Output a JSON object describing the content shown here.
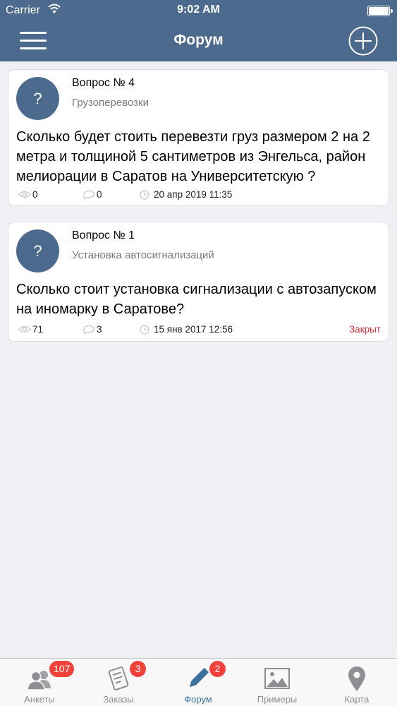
{
  "status_bar": {
    "carrier": "Carrier",
    "time": "9:02 AM"
  },
  "nav": {
    "title": "Форум"
  },
  "questions": [
    {
      "number": "Вопрос № 4",
      "category": "Грузоперевозки",
      "avatar": "?",
      "text": "Сколько будет стоить перевезти груз размером 2 на 2 метра и толщиной 5 сантиметров из Энгельса, район мелиорации в Саратов на Университетскую ?",
      "views": "0",
      "comments": "0",
      "date": "20 апр 2019 11:35",
      "closed_label": ""
    },
    {
      "number": "Вопрос № 1",
      "category": "Установка автосигнализаций",
      "avatar": "?",
      "text": "Сколько стоит установка сигнализации с автозапуском на иномарку в Саратове?",
      "views": "71",
      "comments": "3",
      "date": "15 янв 2017 12:56",
      "closed_label": "Закрыт"
    }
  ],
  "tabs": [
    {
      "label": "Анкеты",
      "badge": "107",
      "icon": "people-icon"
    },
    {
      "label": "Заказы",
      "badge": "3",
      "icon": "orders-icon"
    },
    {
      "label": "Форум",
      "badge": "2",
      "icon": "pencil-icon",
      "active": true
    },
    {
      "label": "Примеры",
      "badge": "",
      "icon": "image-icon"
    },
    {
      "label": "Карта",
      "badge": "",
      "icon": "map-pin-icon"
    }
  ],
  "colors": {
    "primary": "#4b6a8d",
    "background": "#efeff4",
    "badge": "#f2413a",
    "closed": "#d9303b",
    "tab_active": "#3d6f9e",
    "tab_inactive": "#8e8e93"
  }
}
